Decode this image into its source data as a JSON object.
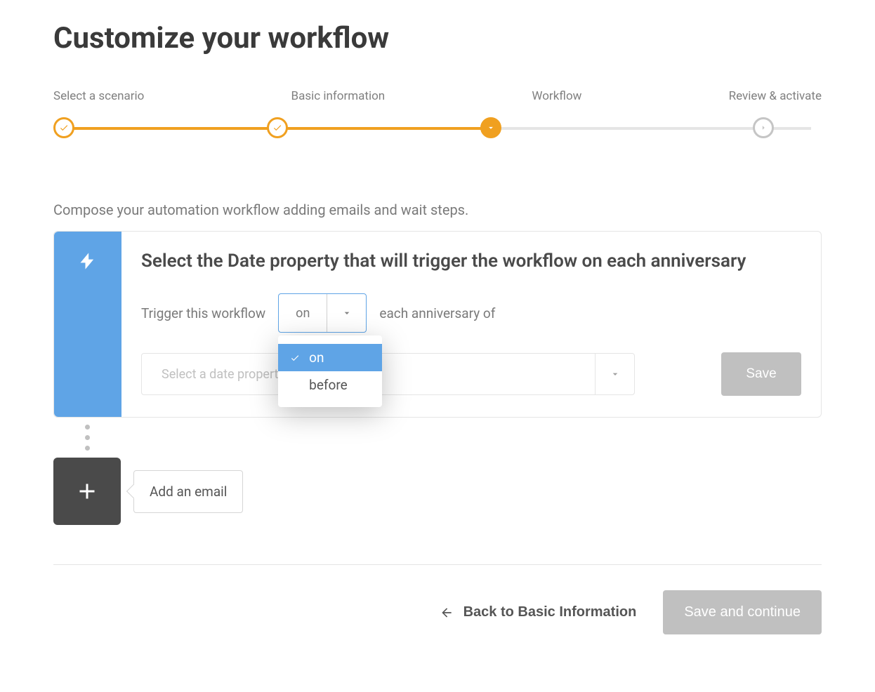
{
  "page": {
    "title": "Customize your workflow",
    "intro": "Compose your automation workflow adding emails and wait steps."
  },
  "stepper": {
    "steps": [
      {
        "label": "Select a scenario",
        "state": "done"
      },
      {
        "label": "Basic information",
        "state": "done"
      },
      {
        "label": "Workflow",
        "state": "current"
      },
      {
        "label": "Review & activate",
        "state": "future"
      }
    ]
  },
  "trigger": {
    "heading": "Select the Date property that will trigger the workflow on each anniversary",
    "pre_text": "Trigger this workflow",
    "timing_value": "on",
    "timing_options": [
      "on",
      "before"
    ],
    "post_text": "each anniversary of",
    "date_property_placeholder": "Select a date property",
    "save_label": "Save"
  },
  "add_step": {
    "label": "Add an email"
  },
  "footer": {
    "back_label": "Back to Basic Information",
    "continue_label": "Save and continue"
  },
  "colors": {
    "accent_orange": "#f0a020",
    "accent_blue": "#5FA4E6",
    "disabled": "#c0c0c0"
  }
}
